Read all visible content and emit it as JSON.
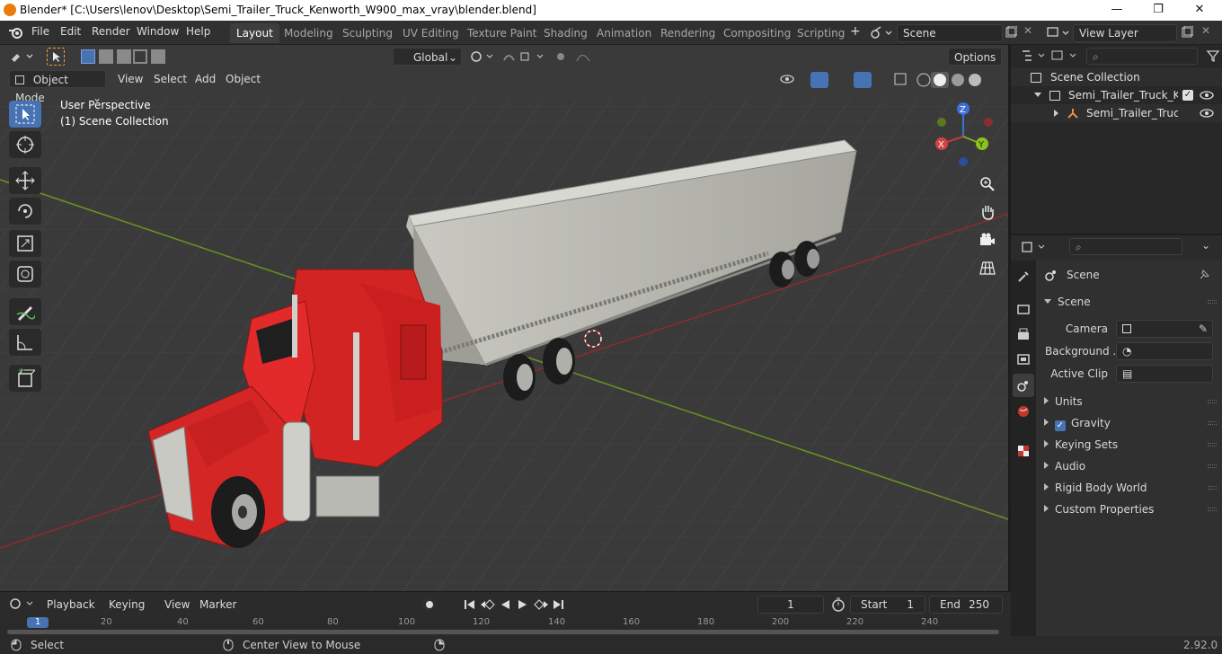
{
  "window": {
    "title": "Blender* [C:\\Users\\lenov\\Desktop\\Semi_Trailer_Truck_Kenworth_W900_max_vray\\blender.blend]",
    "minimize": "—",
    "maximize": "❐",
    "close": "✕"
  },
  "menu": [
    "File",
    "Edit",
    "Render",
    "Window",
    "Help"
  ],
  "workspaces": [
    "Layout",
    "Modeling",
    "Sculpting",
    "UV Editing",
    "Texture Paint",
    "Shading",
    "Animation",
    "Rendering",
    "Compositing",
    "Scripting"
  ],
  "workspace_add": "+",
  "scene_field": "Scene",
  "viewlayer_field": "View Layer",
  "viewport": {
    "mode": "Object Mode",
    "menus": [
      "View",
      "Select",
      "Add",
      "Object"
    ],
    "transform_orientation": "Global",
    "options": "Options",
    "overlay_line1": "User Perspective",
    "overlay_line2": "(1) Scene Collection",
    "gizmo": {
      "z": "Z",
      "x": "X",
      "y": "Y"
    }
  },
  "outliner": {
    "root": "Scene Collection",
    "collection": "Semi_Trailer_Truck_Kenw",
    "object": "Semi_Trailer_Truck_K"
  },
  "properties": {
    "header": "Scene",
    "section": "Scene",
    "fields": [
      {
        "label": "Camera",
        "value": ""
      },
      {
        "label": "Background ...",
        "value": ""
      },
      {
        "label": "Active Clip",
        "value": ""
      }
    ],
    "panels": [
      "Units",
      "Gravity",
      "Keying Sets",
      "Audio",
      "Rigid Body World",
      "Custom Properties"
    ],
    "gravity_checked": true
  },
  "timeline": {
    "menus": [
      "Playback",
      "Keying",
      "View",
      "Marker"
    ],
    "current_frame": "1",
    "start_label": "Start",
    "start": "1",
    "end_label": "End",
    "end": "250",
    "ruler": [
      "1",
      "20",
      "40",
      "60",
      "80",
      "100",
      "120",
      "140",
      "160",
      "180",
      "200",
      "220",
      "240"
    ]
  },
  "status": {
    "left": "Select",
    "middle": "Center View to Mouse",
    "version": "2.92.0"
  },
  "colors": {
    "accent": "#4772b3",
    "truck_red": "#d32424",
    "trailer_gray": "#b8b8b0",
    "axis_x": "#8b2c2c",
    "axis_y": "#6b8f23"
  }
}
